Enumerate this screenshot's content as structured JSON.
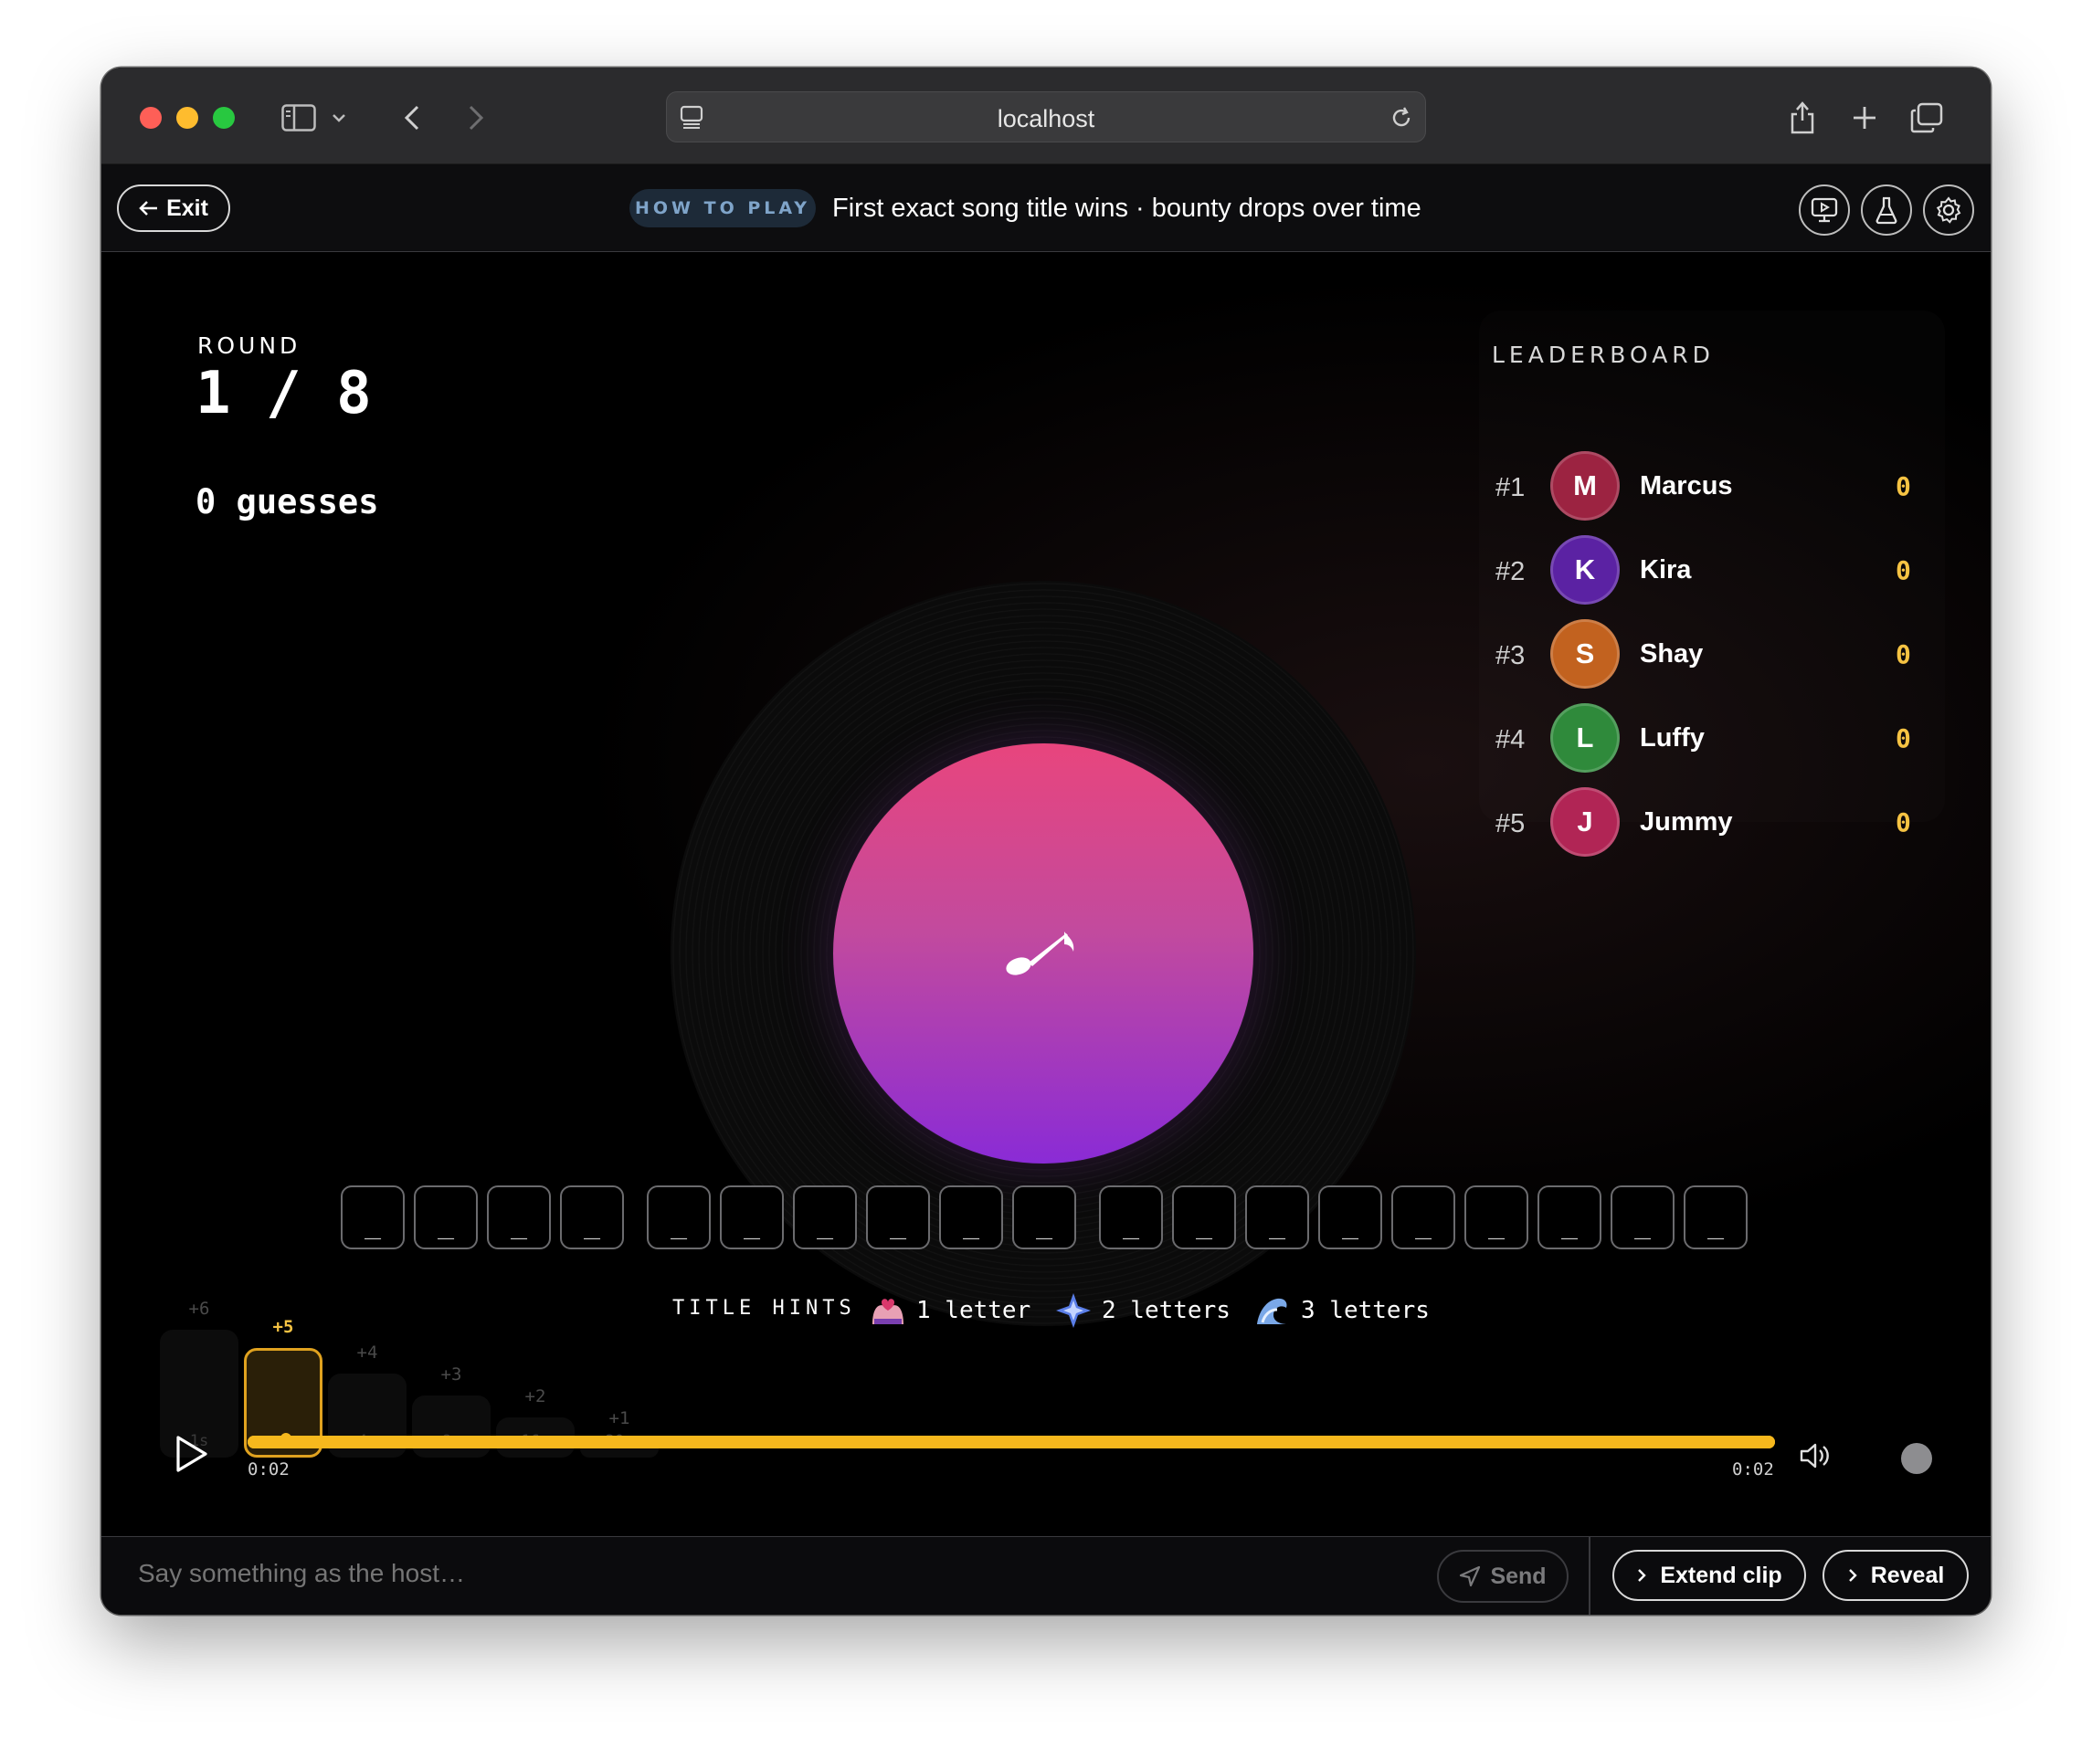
{
  "browser": {
    "address": "localhost"
  },
  "header": {
    "exit_label": "Exit",
    "howto_badge": "HOW TO PLAY",
    "howto_text": "First exact song title wins · bounty drops over time"
  },
  "round": {
    "label": "ROUND",
    "value": "1 / 8",
    "guesses": "0 guesses"
  },
  "leaderboard": {
    "title": "LEADERBOARD",
    "players": [
      {
        "rank": "#1",
        "initial": "M",
        "name": "Marcus",
        "score": "0",
        "color": "#9c2341"
      },
      {
        "rank": "#2",
        "initial": "K",
        "name": "Kira",
        "score": "0",
        "color": "#5b22a3"
      },
      {
        "rank": "#3",
        "initial": "S",
        "name": "Shay",
        "score": "0",
        "color": "#c2621f"
      },
      {
        "rank": "#4",
        "initial": "L",
        "name": "Luffy",
        "score": "0",
        "color": "#2f8a3b"
      },
      {
        "rank": "#5",
        "initial": "J",
        "name": "Jummy",
        "score": "0",
        "color": "#b12555"
      }
    ]
  },
  "title_slots": {
    "placeholder": "_",
    "groups": [
      4,
      6,
      9
    ]
  },
  "hints": {
    "label": "TITLE HINTS",
    "items": [
      {
        "text": "1 letter",
        "icon": "hands-heart-icon"
      },
      {
        "text": "2 letters",
        "icon": "sparkle-crystal-icon"
      },
      {
        "text": "3 letters",
        "icon": "wave-splash-icon"
      }
    ]
  },
  "bounty": {
    "steps": [
      {
        "points": "+6",
        "time": "1s"
      },
      {
        "points": "+5",
        "time": ""
      },
      {
        "points": "+4",
        "time": "4s"
      },
      {
        "points": "+3",
        "time": "8s"
      },
      {
        "points": "+2",
        "time": "16s"
      },
      {
        "points": "+1",
        "time": "30s"
      }
    ],
    "active_index": 1
  },
  "player": {
    "elapsed": "0:02",
    "total": "0:02",
    "progress": 1.0
  },
  "chat": {
    "placeholder": "Say something as the host…",
    "send_label": "Send",
    "extend_label": "Extend clip",
    "reveal_label": "Reveal"
  },
  "colors": {
    "accent": "#f6b81d",
    "disc_top": "#e8457d",
    "disc_bottom": "#8a2bd6",
    "score": "#f6c343"
  }
}
